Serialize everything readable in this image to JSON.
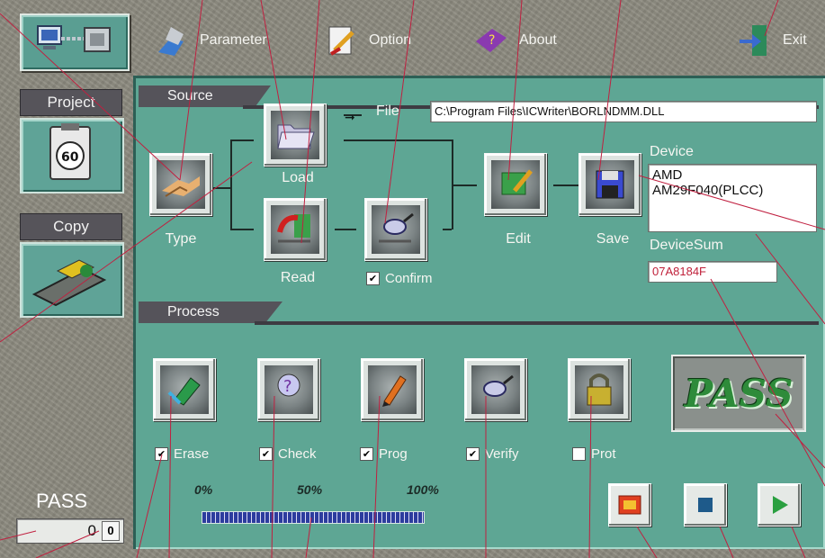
{
  "menu": {
    "parameter": "Parameter",
    "option": "Option",
    "about": "About",
    "exit": "Exit"
  },
  "sidebar": {
    "project": "Project",
    "project_badge": "60",
    "copy": "Copy",
    "status": "PASS",
    "counter": "0",
    "counter_small": "0"
  },
  "source": {
    "title": "Source",
    "type": "Type",
    "load": "Load",
    "read": "Read",
    "confirm": "Confirm",
    "confirm_checked": true,
    "edit": "Edit",
    "save": "Save",
    "file_label": "File",
    "file_path": "C:\\Program Files\\ICWriter\\BORLNDMM.DLL",
    "device_label": "Device",
    "device_line1": "AMD",
    "device_line2": "AM29F040(PLCC)",
    "devicesum_label": "DeviceSum",
    "devicesum_value": "07A8184F"
  },
  "process": {
    "title": "Process",
    "steps": [
      {
        "label": "Erase",
        "checked": true
      },
      {
        "label": "Check",
        "checked": true
      },
      {
        "label": "Prog",
        "checked": true
      },
      {
        "label": "Verify",
        "checked": true
      },
      {
        "label": "Prot",
        "checked": false
      }
    ],
    "result": "PASS",
    "progress_0": "0%",
    "progress_50": "50%",
    "progress_100": "100%",
    "progress_value": 1.0
  },
  "colors": {
    "panel": "#5ea694",
    "title_bar": "#55535a",
    "pass_text": "#2e8b3a",
    "devicesum_text": "#c0203a",
    "progress": "#2c3c9e"
  }
}
